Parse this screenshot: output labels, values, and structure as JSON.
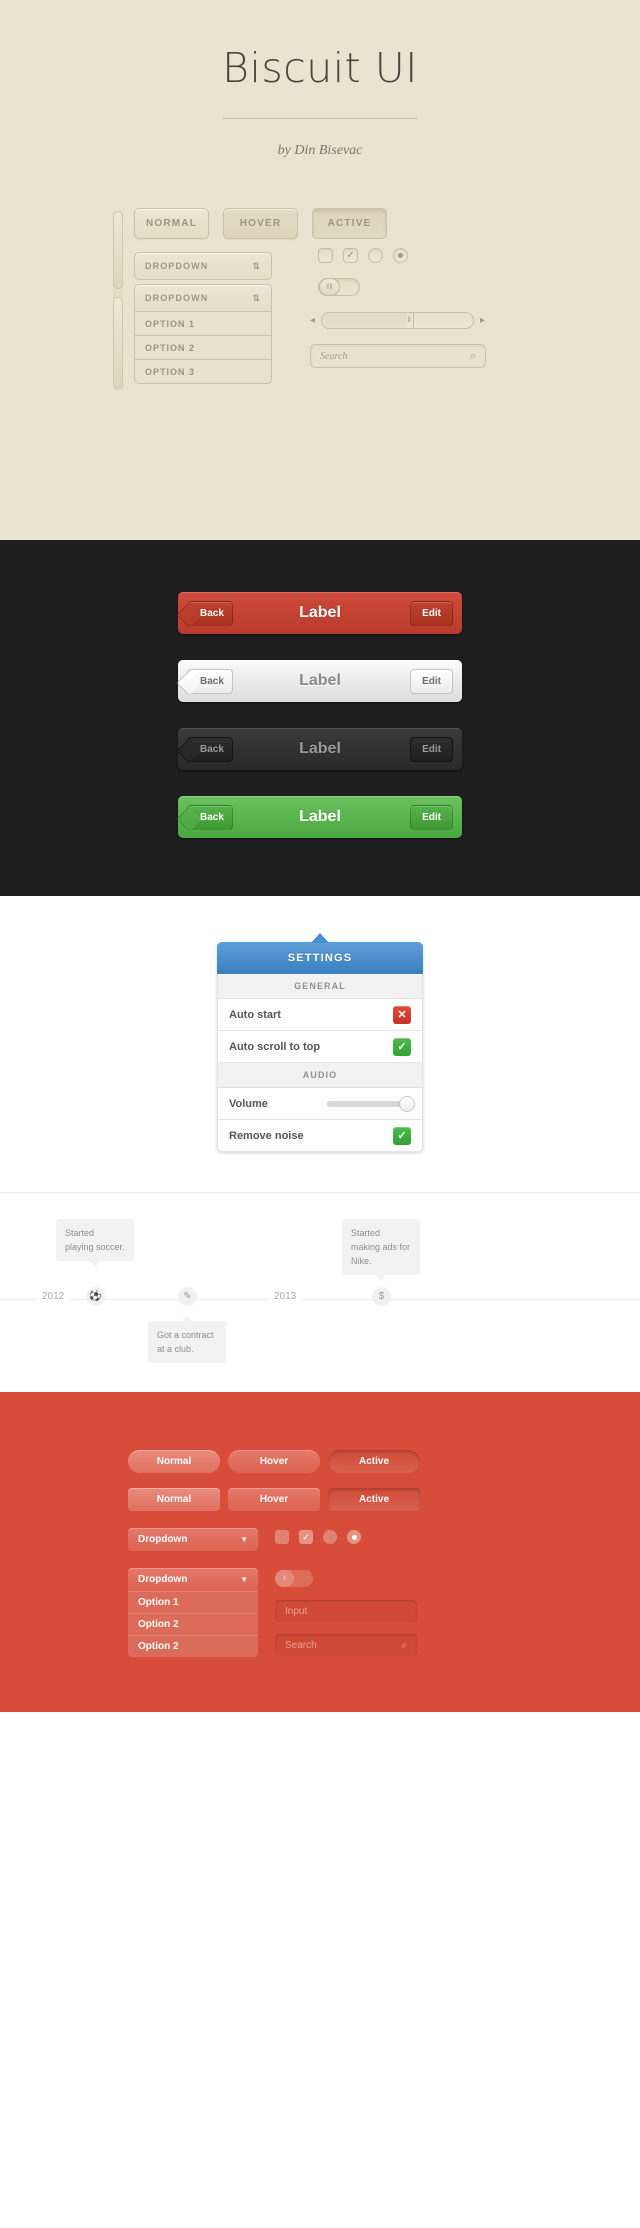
{
  "cream": {
    "title": "Biscuit UI",
    "byline": "by Din Bisevac",
    "buttons": [
      {
        "label": "NORMAL",
        "state": "normal"
      },
      {
        "label": "HOVER",
        "state": "hover"
      },
      {
        "label": "ACTIVE",
        "state": "active"
      }
    ],
    "dropdown1": {
      "label": "DROPDOWN",
      "caret": "⇅"
    },
    "dropdown2": {
      "label": "DROPDOWN",
      "caret": "⇅"
    },
    "options": [
      "OPTION 1",
      "OPTION 2",
      "OPTION 3"
    ],
    "checkbox_unchecked": "",
    "checkbox_checked": "✓",
    "radio_unchecked": "",
    "radio_checked": "●",
    "toggle_grip": "‖‖",
    "slider": {
      "speaker_low": "◂",
      "speaker_high": "▸",
      "grip": "‖",
      "value_percent": 60
    },
    "search": {
      "placeholder": "Search",
      "icon": "⌕"
    }
  },
  "navbars": [
    {
      "variant": "red",
      "back": "Back",
      "label": "Label",
      "edit": "Edit",
      "color": "#c3402f"
    },
    {
      "variant": "light",
      "back": "Back",
      "label": "Label",
      "edit": "Edit",
      "color": "#ededed"
    },
    {
      "variant": "dark",
      "back": "Back",
      "label": "Label",
      "edit": "Edit",
      "color": "#2e2e2e"
    },
    {
      "variant": "green",
      "back": "Back",
      "label": "Label",
      "edit": "Edit",
      "color": "#56b44a"
    }
  ],
  "settings": {
    "title": "SETTINGS",
    "group_general": "GENERAL",
    "group_audio": "AUDIO",
    "rows": [
      {
        "label": "Auto start",
        "control": "toggle-off",
        "glyph": "✕",
        "color": "#d63c2d"
      },
      {
        "label": "Auto scroll to top",
        "control": "toggle-on",
        "glyph": "✓",
        "color": "#3fae3f"
      },
      {
        "label": "Volume",
        "control": "slider",
        "value_percent": 100
      },
      {
        "label": "Remove noise",
        "control": "toggle-on",
        "glyph": "✓",
        "color": "#3fae3f"
      }
    ]
  },
  "timeline": {
    "years": [
      "2012",
      "2013"
    ],
    "events": [
      {
        "text": "Started playing soccer.",
        "icon": "⚽",
        "position": "above"
      },
      {
        "text": "Got a contract at a club.",
        "icon": "✎",
        "position": "below"
      },
      {
        "text": "Started making ads for Nike.",
        "icon": "$",
        "position": "above"
      }
    ]
  },
  "red": {
    "pill_buttons": [
      {
        "label": "Normal",
        "state": "normal"
      },
      {
        "label": "Hover",
        "state": "hover"
      },
      {
        "label": "Active",
        "state": "active"
      }
    ],
    "rect_buttons": [
      {
        "label": "Normal",
        "state": "normal"
      },
      {
        "label": "Hover",
        "state": "hover"
      },
      {
        "label": "Active",
        "state": "active"
      }
    ],
    "dropdown1": {
      "label": "Dropdown",
      "caret": "▼"
    },
    "dropdown2": {
      "label": "Dropdown",
      "caret": "▼"
    },
    "options": [
      "Option 1",
      "Option 2",
      "Option 2"
    ],
    "checkbox_checked": "✓",
    "toggle_grip": "‖",
    "input": {
      "placeholder": "Input"
    },
    "search": {
      "placeholder": "Search",
      "icon": "⌕"
    }
  }
}
